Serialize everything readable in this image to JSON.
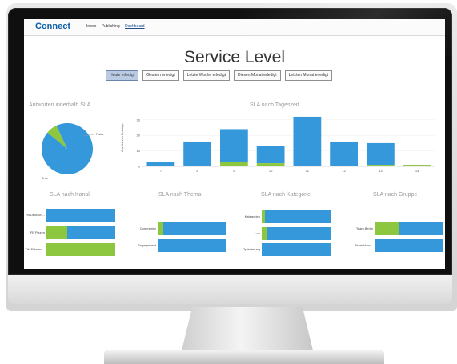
{
  "app": {
    "brand": "Connect"
  },
  "nav": {
    "items": [
      "Inbox",
      "Publishing",
      "Dashboard"
    ],
    "active_index": 2
  },
  "page": {
    "title": "Service Level",
    "filters": [
      "Heute erledigt",
      "Gestern erledigt",
      "Letzte Woche erledigt",
      "Diesen Monat erledigt",
      "Letzten Monat erledigt"
    ],
    "active_filter": 0
  },
  "sections": {
    "sla": "Antworten innerhalb SLA",
    "tageszeit": "SLA nach Tageszeit",
    "kanal": "SLA nach Kanal",
    "thema": "SLA nach Thema",
    "kategorie": "SLA nach Kategorie",
    "gruppe": "SLA nach Gruppe"
  },
  "colors": {
    "blue": "#3498db",
    "green": "#8dc63f"
  },
  "chart_data": [
    {
      "type": "pie",
      "title": "Antworten innerhalb SLA",
      "labels": [
        "True",
        "False"
      ],
      "values": [
        93,
        7
      ]
    },
    {
      "type": "bar",
      "title": "SLA nach Tageszeit",
      "ylabel": "Anzahl von Beiträge",
      "categories": [
        "7",
        "8",
        "9",
        "10",
        "11",
        "12",
        "13",
        "14"
      ],
      "ticks": [
        0,
        10,
        20,
        30
      ],
      "ylim": [
        0,
        33
      ],
      "series": [
        {
          "values": [
            3,
            16,
            21,
            11,
            32,
            16,
            14,
            0
          ]
        },
        {
          "values": [
            0,
            0,
            3,
            2,
            0,
            0,
            1,
            1
          ]
        }
      ]
    },
    {
      "type": "bar",
      "title": "SLA nach Kanal",
      "categories": [
        "FB Deutsch...",
        "FB Pizzen",
        "TW Führern..."
      ],
      "series": [
        {
          "values": [
            0,
            0.3,
            1
          ]
        },
        {
          "values": [
            1,
            0.7,
            0
          ]
        }
      ]
    },
    {
      "type": "bar",
      "title": "SLA nach Thema",
      "categories": [
        "Community",
        "Engagement"
      ],
      "series": [
        {
          "values": [
            0.08,
            0
          ]
        },
        {
          "values": [
            0.92,
            1
          ]
        }
      ]
    },
    {
      "type": "bar",
      "title": "SLA nach Kategorie",
      "categories": [
        "Kategorien",
        "Lob",
        "Optimierung"
      ],
      "series": [
        {
          "values": [
            0.05,
            0.08,
            0
          ]
        },
        {
          "values": [
            0.95,
            0.92,
            1
          ]
        }
      ]
    },
    {
      "type": "bar",
      "title": "SLA nach Gruppe",
      "categories": [
        "Team Berlin",
        "Team Ham..."
      ],
      "series": [
        {
          "values": [
            0.36,
            0
          ]
        },
        {
          "values": [
            0.64,
            1
          ]
        }
      ]
    }
  ]
}
